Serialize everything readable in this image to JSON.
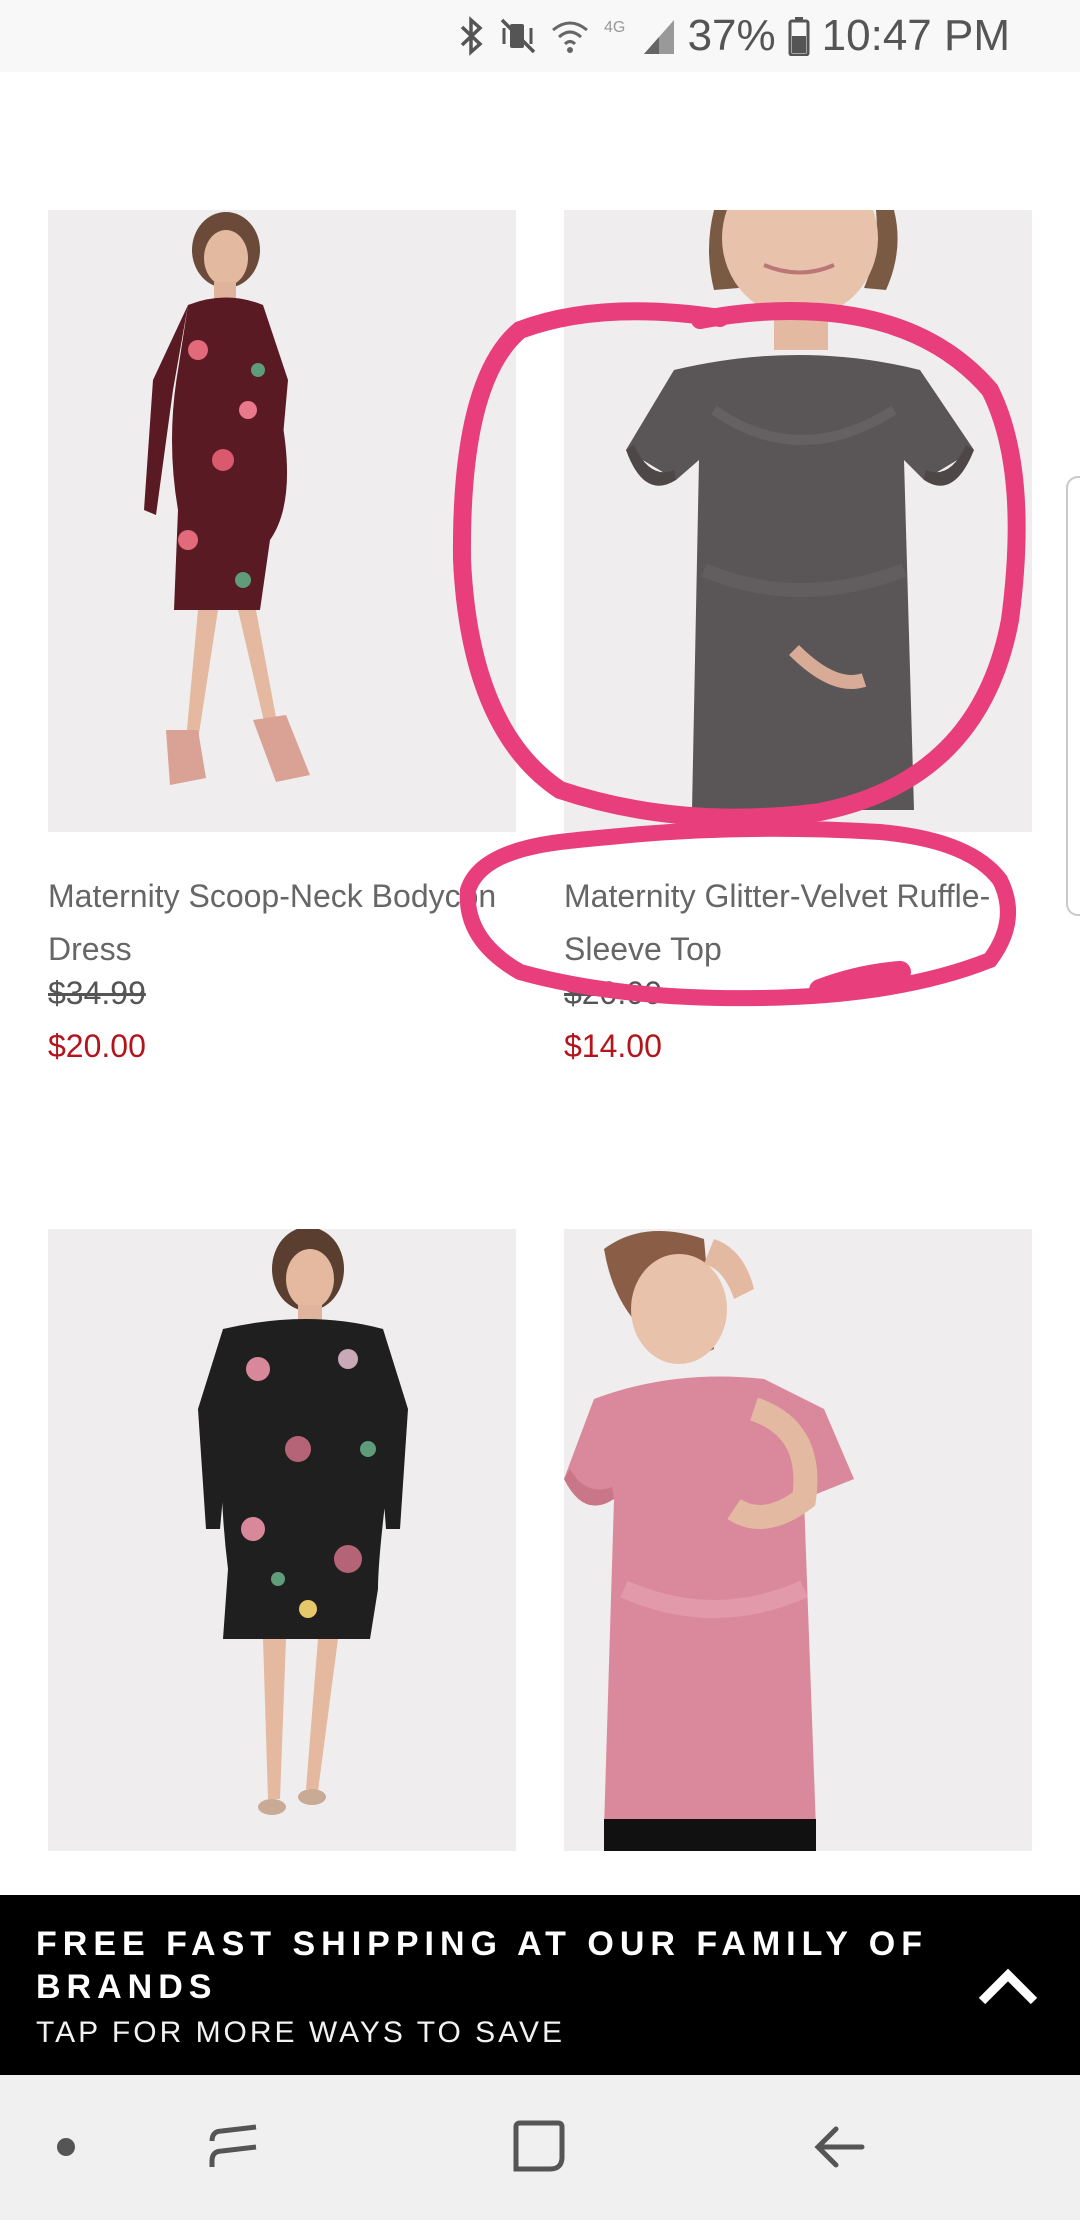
{
  "status_bar": {
    "icons": [
      "bluetooth-icon",
      "vibrate-mute-icon",
      "wifi-icon",
      "lte-signal-icon",
      "battery-icon"
    ],
    "network": "4G",
    "battery": "37%",
    "time": "10:47 PM"
  },
  "products": [
    {
      "name": "Maternity Scoop-Neck Bodycon Dress",
      "original_price": "$34.99",
      "sale_price": "$20.00",
      "image": "maternity-floral-dress-photo"
    },
    {
      "name": "Maternity Glitter-Velvet Ruffle-Sleeve Top",
      "original_price": "$20.00",
      "sale_price": "$14.00",
      "image": "maternity-velvet-top-photo"
    },
    {
      "name": "",
      "original_price": "",
      "sale_price": "",
      "image": "maternity-black-floral-dress-photo"
    },
    {
      "name": "",
      "original_price": "",
      "sale_price": "",
      "image": "maternity-pink-velvet-top-photo"
    }
  ],
  "promo_banner": {
    "title": "FREE FAST SHIPPING AT OUR FAMILY OF BRANDS",
    "subtitle": "TAP FOR MORE WAYS TO SAVE",
    "icon": "chevron-up-icon"
  },
  "nav_bar": {
    "icons": [
      "nav-dot-icon",
      "recent-apps-icon",
      "home-icon",
      "back-icon"
    ]
  },
  "colors": {
    "sale_price": "#b3151c",
    "annotation": "#e83e7c",
    "banner_bg": "#000000",
    "product_bg": "#f0eeee"
  }
}
